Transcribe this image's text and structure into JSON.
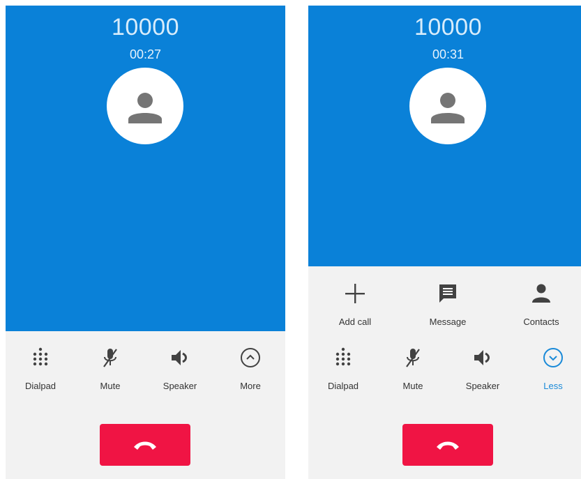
{
  "screens": [
    {
      "caller_number": "10000",
      "timer": "00:27",
      "controls": [
        {
          "label": "Dialpad",
          "icon": "dialpad-icon"
        },
        {
          "label": "Mute",
          "icon": "mic-off-icon"
        },
        {
          "label": "Speaker",
          "icon": "speaker-icon"
        },
        {
          "label": "More",
          "icon": "chevron-up-circle-icon"
        }
      ]
    },
    {
      "caller_number": "10000",
      "timer": "00:31",
      "extra_controls": [
        {
          "label": "Add call",
          "icon": "plus-icon"
        },
        {
          "label": "Message",
          "icon": "message-icon"
        },
        {
          "label": "Contacts",
          "icon": "person-icon"
        }
      ],
      "controls": [
        {
          "label": "Dialpad",
          "icon": "dialpad-icon"
        },
        {
          "label": "Mute",
          "icon": "mic-off-icon"
        },
        {
          "label": "Speaker",
          "icon": "speaker-icon"
        },
        {
          "label": "Less",
          "icon": "chevron-down-circle-icon"
        }
      ]
    }
  ],
  "colors": {
    "header_blue": "#0a81d8",
    "end_call_red": "#f01444",
    "accent_blue": "#1a8ad8",
    "panel_gray": "#f2f2f2"
  }
}
